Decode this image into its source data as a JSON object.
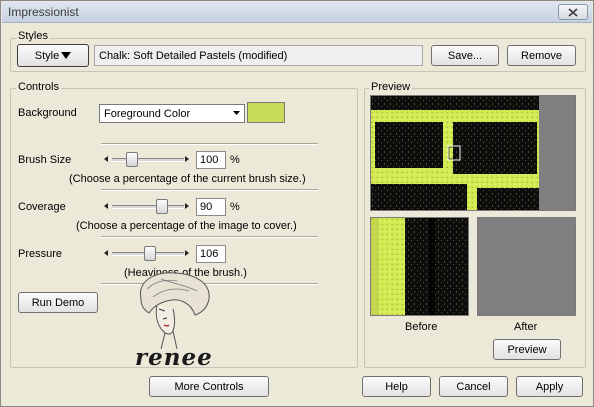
{
  "window": {
    "title": "Impressionist"
  },
  "styles": {
    "label": "Styles",
    "style_button": "Style",
    "preset_name": "Chalk: Soft Detailed Pastels (modified)",
    "save_button": "Save...",
    "remove_button": "Remove"
  },
  "controls": {
    "label": "Controls",
    "background_label": "Background",
    "background_value": "Foreground Color",
    "background_swatch_color": "#c8dc5a",
    "brush_size": {
      "label": "Brush Size",
      "value": "100",
      "unit": "%",
      "hint": "(Choose a percentage of the current brush size.)",
      "level": 0.24
    },
    "coverage": {
      "label": "Coverage",
      "value": "90",
      "unit": "%",
      "hint": "(Choose a percentage of the image to cover.)",
      "level": 0.74
    },
    "pressure": {
      "label": "Pressure",
      "value": "106",
      "hint": "(Heaviness of the brush.)",
      "level": 0.53
    },
    "run_demo_button": "Run Demo"
  },
  "preview": {
    "label": "Preview",
    "before_label": "Before",
    "after_label": "After",
    "preview_button": "Preview"
  },
  "watermark": {
    "signature": "renee"
  },
  "footer": {
    "more_controls_button": "More Controls",
    "help_button": "Help",
    "cancel_button": "Cancel",
    "apply_button": "Apply"
  },
  "colors": {
    "chalk_yellow": "#d4ea52",
    "texture_dark": "#101010"
  }
}
